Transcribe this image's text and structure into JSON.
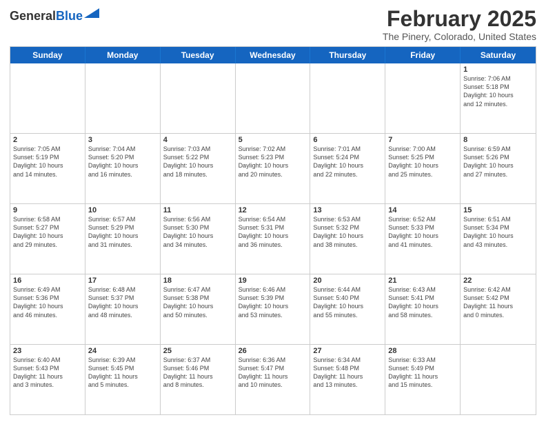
{
  "header": {
    "logo_general": "General",
    "logo_blue": "Blue",
    "title": "February 2025",
    "subtitle": "The Pinery, Colorado, United States"
  },
  "weekdays": [
    "Sunday",
    "Monday",
    "Tuesday",
    "Wednesday",
    "Thursday",
    "Friday",
    "Saturday"
  ],
  "rows": [
    [
      {
        "day": "",
        "text": ""
      },
      {
        "day": "",
        "text": ""
      },
      {
        "day": "",
        "text": ""
      },
      {
        "day": "",
        "text": ""
      },
      {
        "day": "",
        "text": ""
      },
      {
        "day": "",
        "text": ""
      },
      {
        "day": "1",
        "text": "Sunrise: 7:06 AM\nSunset: 5:18 PM\nDaylight: 10 hours\nand 12 minutes."
      }
    ],
    [
      {
        "day": "2",
        "text": "Sunrise: 7:05 AM\nSunset: 5:19 PM\nDaylight: 10 hours\nand 14 minutes."
      },
      {
        "day": "3",
        "text": "Sunrise: 7:04 AM\nSunset: 5:20 PM\nDaylight: 10 hours\nand 16 minutes."
      },
      {
        "day": "4",
        "text": "Sunrise: 7:03 AM\nSunset: 5:22 PM\nDaylight: 10 hours\nand 18 minutes."
      },
      {
        "day": "5",
        "text": "Sunrise: 7:02 AM\nSunset: 5:23 PM\nDaylight: 10 hours\nand 20 minutes."
      },
      {
        "day": "6",
        "text": "Sunrise: 7:01 AM\nSunset: 5:24 PM\nDaylight: 10 hours\nand 22 minutes."
      },
      {
        "day": "7",
        "text": "Sunrise: 7:00 AM\nSunset: 5:25 PM\nDaylight: 10 hours\nand 25 minutes."
      },
      {
        "day": "8",
        "text": "Sunrise: 6:59 AM\nSunset: 5:26 PM\nDaylight: 10 hours\nand 27 minutes."
      }
    ],
    [
      {
        "day": "9",
        "text": "Sunrise: 6:58 AM\nSunset: 5:27 PM\nDaylight: 10 hours\nand 29 minutes."
      },
      {
        "day": "10",
        "text": "Sunrise: 6:57 AM\nSunset: 5:29 PM\nDaylight: 10 hours\nand 31 minutes."
      },
      {
        "day": "11",
        "text": "Sunrise: 6:56 AM\nSunset: 5:30 PM\nDaylight: 10 hours\nand 34 minutes."
      },
      {
        "day": "12",
        "text": "Sunrise: 6:54 AM\nSunset: 5:31 PM\nDaylight: 10 hours\nand 36 minutes."
      },
      {
        "day": "13",
        "text": "Sunrise: 6:53 AM\nSunset: 5:32 PM\nDaylight: 10 hours\nand 38 minutes."
      },
      {
        "day": "14",
        "text": "Sunrise: 6:52 AM\nSunset: 5:33 PM\nDaylight: 10 hours\nand 41 minutes."
      },
      {
        "day": "15",
        "text": "Sunrise: 6:51 AM\nSunset: 5:34 PM\nDaylight: 10 hours\nand 43 minutes."
      }
    ],
    [
      {
        "day": "16",
        "text": "Sunrise: 6:49 AM\nSunset: 5:36 PM\nDaylight: 10 hours\nand 46 minutes."
      },
      {
        "day": "17",
        "text": "Sunrise: 6:48 AM\nSunset: 5:37 PM\nDaylight: 10 hours\nand 48 minutes."
      },
      {
        "day": "18",
        "text": "Sunrise: 6:47 AM\nSunset: 5:38 PM\nDaylight: 10 hours\nand 50 minutes."
      },
      {
        "day": "19",
        "text": "Sunrise: 6:46 AM\nSunset: 5:39 PM\nDaylight: 10 hours\nand 53 minutes."
      },
      {
        "day": "20",
        "text": "Sunrise: 6:44 AM\nSunset: 5:40 PM\nDaylight: 10 hours\nand 55 minutes."
      },
      {
        "day": "21",
        "text": "Sunrise: 6:43 AM\nSunset: 5:41 PM\nDaylight: 10 hours\nand 58 minutes."
      },
      {
        "day": "22",
        "text": "Sunrise: 6:42 AM\nSunset: 5:42 PM\nDaylight: 11 hours\nand 0 minutes."
      }
    ],
    [
      {
        "day": "23",
        "text": "Sunrise: 6:40 AM\nSunset: 5:43 PM\nDaylight: 11 hours\nand 3 minutes."
      },
      {
        "day": "24",
        "text": "Sunrise: 6:39 AM\nSunset: 5:45 PM\nDaylight: 11 hours\nand 5 minutes."
      },
      {
        "day": "25",
        "text": "Sunrise: 6:37 AM\nSunset: 5:46 PM\nDaylight: 11 hours\nand 8 minutes."
      },
      {
        "day": "26",
        "text": "Sunrise: 6:36 AM\nSunset: 5:47 PM\nDaylight: 11 hours\nand 10 minutes."
      },
      {
        "day": "27",
        "text": "Sunrise: 6:34 AM\nSunset: 5:48 PM\nDaylight: 11 hours\nand 13 minutes."
      },
      {
        "day": "28",
        "text": "Sunrise: 6:33 AM\nSunset: 5:49 PM\nDaylight: 11 hours\nand 15 minutes."
      },
      {
        "day": "",
        "text": ""
      }
    ]
  ]
}
